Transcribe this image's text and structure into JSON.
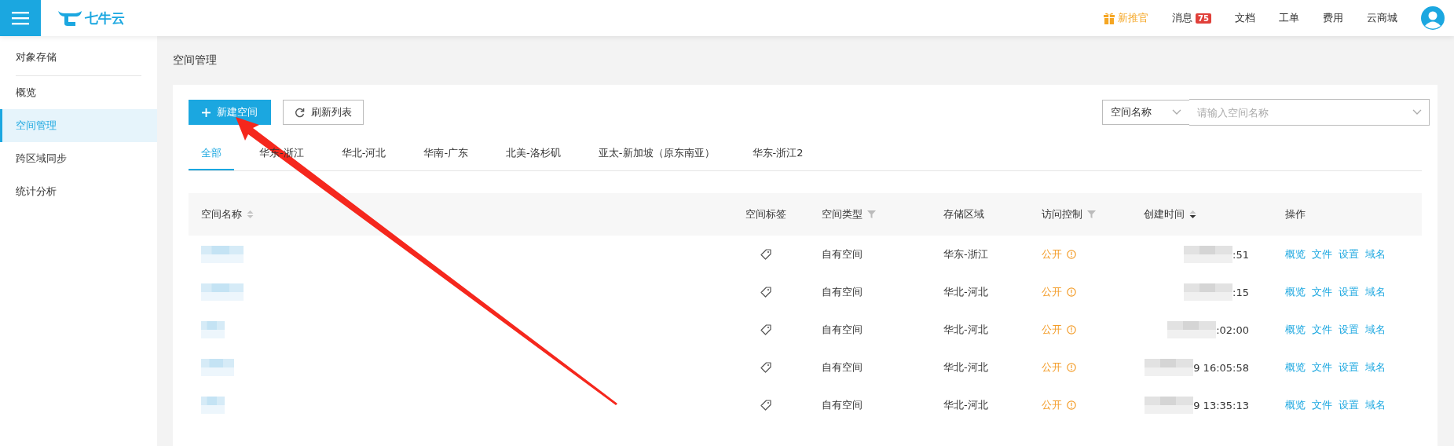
{
  "header": {
    "logo": "七牛云",
    "links": [
      {
        "kind": "promo",
        "label": "新推官"
      },
      {
        "kind": "badge",
        "label": "消息",
        "badge": "75"
      },
      {
        "kind": "plain",
        "label": "文档"
      },
      {
        "kind": "plain",
        "label": "工单"
      },
      {
        "kind": "plain",
        "label": "费用"
      },
      {
        "kind": "plain",
        "label": "云商城"
      }
    ]
  },
  "sidebar": {
    "heading": "对象存储",
    "items": [
      {
        "label": "概览",
        "selected": false
      },
      {
        "label": "空间管理",
        "selected": true
      },
      {
        "label": "跨区域同步",
        "selected": false
      },
      {
        "label": "统计分析",
        "selected": false
      }
    ]
  },
  "page_title": "空间管理",
  "toolbar": {
    "create_button": "新建空间",
    "refresh_button": "刷新列表",
    "search": {
      "filter_select": "空间名称",
      "placeholder": "请输入空间名称"
    }
  },
  "tabs": [
    {
      "label": "全部",
      "selected": true
    },
    {
      "label": "华东-浙江",
      "selected": false
    },
    {
      "label": "华北-河北",
      "selected": false
    },
    {
      "label": "华南-广东",
      "selected": false
    },
    {
      "label": "北美-洛杉矶",
      "selected": false
    },
    {
      "label": "亚太-新加坡（原东南亚）",
      "selected": false
    },
    {
      "label": "华东-浙江2",
      "selected": false
    }
  ],
  "table": {
    "columns": [
      {
        "label": "空间名称",
        "kind": "sortable"
      },
      {
        "label": "空间标签",
        "kind": "plain"
      },
      {
        "label": "空间类型",
        "kind": "filterable"
      },
      {
        "label": "存储区域",
        "kind": "plain"
      },
      {
        "label": "访问控制",
        "kind": "filterable"
      },
      {
        "label": "创建时间",
        "kind": "sorted-desc"
      },
      {
        "label": "操作",
        "kind": "plain"
      }
    ],
    "rows": [
      {
        "type": "自有空间",
        "region": "华东-浙江",
        "access": "公开",
        "time_end": ":51",
        "actions": [
          "概览",
          "文件",
          "设置",
          "域名"
        ]
      },
      {
        "type": "自有空间",
        "region": "华北-河北",
        "access": "公开",
        "time_end": ":15",
        "actions": [
          "概览",
          "文件",
          "设置",
          "域名"
        ]
      },
      {
        "type": "自有空间",
        "region": "华北-河北",
        "access": "公开",
        "time_end": ":02:00",
        "actions": [
          "概览",
          "文件",
          "设置",
          "域名"
        ]
      },
      {
        "type": "自有空间",
        "region": "华北-河北",
        "access": "公开",
        "time_end": "9 16:05:58",
        "actions": [
          "概览",
          "文件",
          "设置",
          "域名"
        ]
      },
      {
        "type": "自有空间",
        "region": "华北-河北",
        "access": "公开",
        "time_end": "9 13:35:13",
        "actions": [
          "概览",
          "文件",
          "设置",
          "域名"
        ]
      }
    ]
  }
}
